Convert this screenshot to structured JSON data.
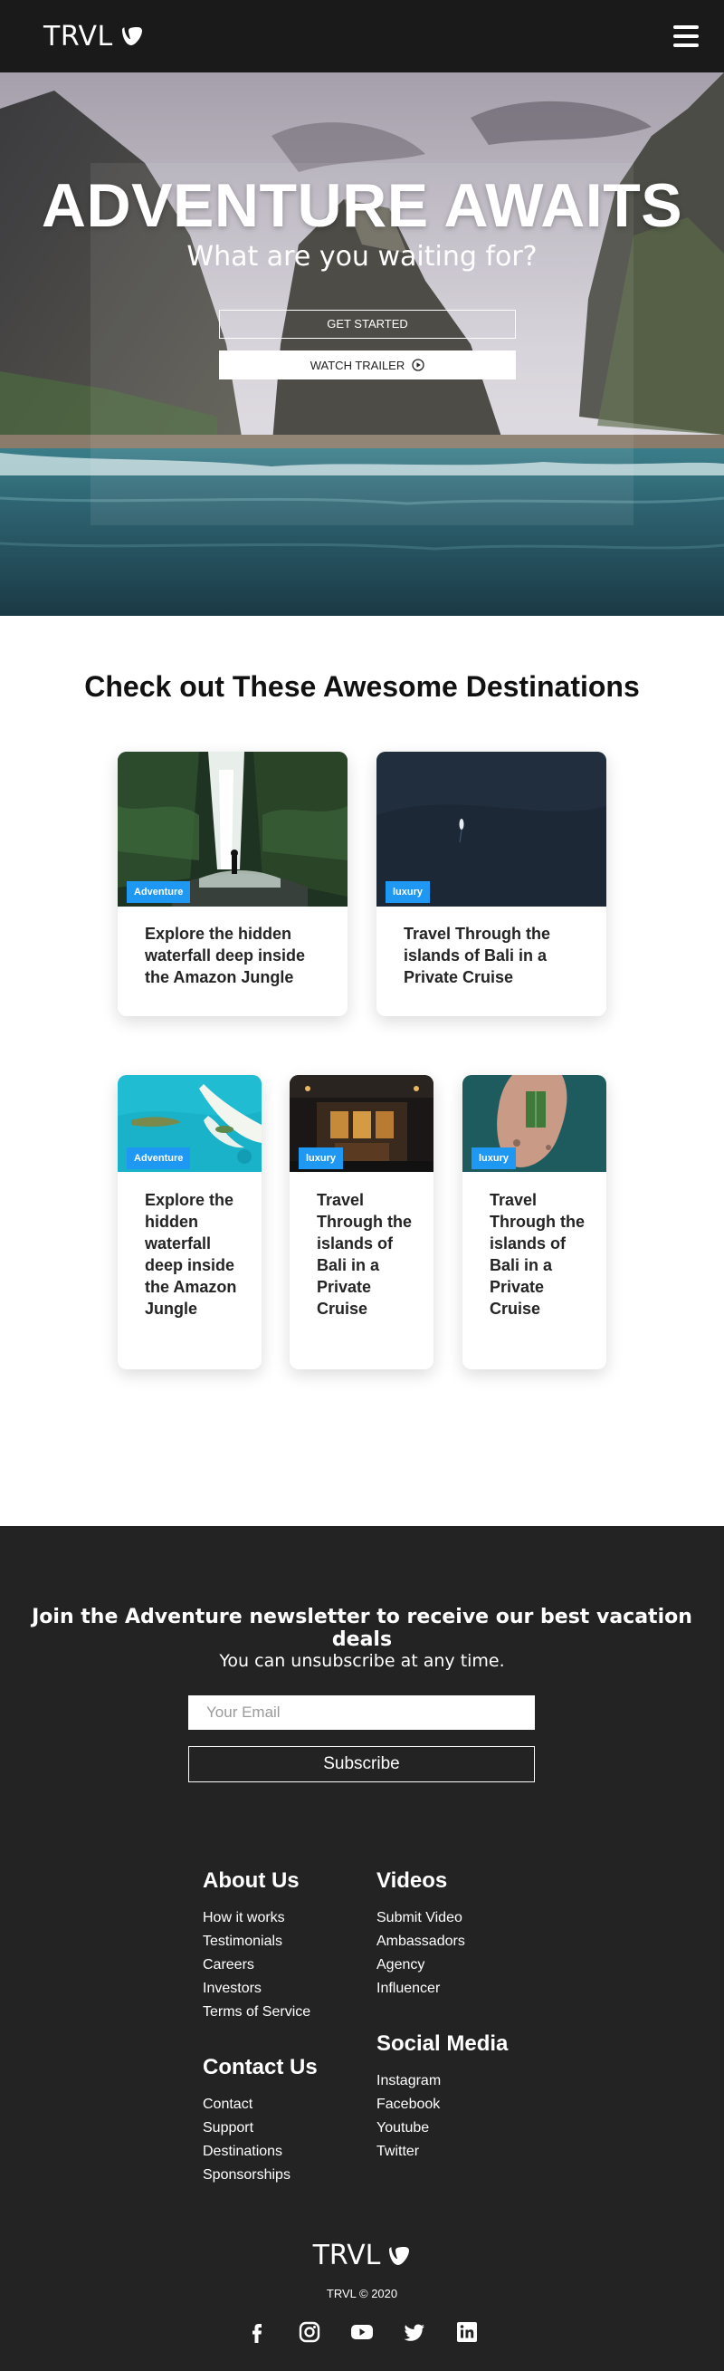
{
  "brand": {
    "name": "TRVL"
  },
  "hero": {
    "title": "ADVENTURE AWAITS",
    "subtitle": "What are you waiting for?",
    "get_started_label": "GET STARTED",
    "watch_trailer_label": "WATCH TRAILER"
  },
  "destinations": {
    "heading": "Check out These Awesome Destinations",
    "cards": [
      {
        "tag": "Adventure",
        "text": "Explore the hidden waterfall deep inside the Amazon Jungle",
        "image": "waterfall-jungle"
      },
      {
        "tag": "luxury",
        "text": "Travel Through the islands of Bali in a Private Cruise",
        "image": "boat-ocean"
      },
      {
        "tag": "Adventure",
        "text": "Explore the hidden waterfall deep inside the Amazon Jungle",
        "image": "tropical-reef"
      },
      {
        "tag": "luxury",
        "text": "Travel Through the islands of Bali in a Private Cruise",
        "image": "night-building"
      },
      {
        "tag": "luxury",
        "text": "Travel Through the islands of Bali in a Private Cruise",
        "image": "island-field"
      }
    ]
  },
  "newsletter": {
    "title": "Join the Adventure newsletter to receive our best vacation deals",
    "subtitle": "You can unsubscribe at any time.",
    "email_placeholder": "Your Email",
    "subscribe_label": "Subscribe"
  },
  "footer": {
    "about": {
      "title": "About Us",
      "links": [
        "How it works",
        "Testimonials",
        "Careers",
        "Investors",
        "Terms of Service"
      ]
    },
    "videos": {
      "title": "Videos",
      "links": [
        "Submit Video",
        "Ambassadors",
        "Agency",
        "Influencer"
      ]
    },
    "contact": {
      "title": "Contact Us",
      "links": [
        "Contact",
        "Support",
        "Destinations",
        "Sponsorships"
      ]
    },
    "social": {
      "title": "Social Media",
      "links": [
        "Instagram",
        "Facebook",
        "Youtube",
        "Twitter"
      ]
    },
    "copyright": "TRVL © 2020",
    "social_icons": [
      "facebook-icon",
      "instagram-icon",
      "youtube-icon",
      "twitter-icon",
      "linkedin-icon"
    ]
  },
  "colors": {
    "navbar": "#1a1a1a",
    "footer": "#232323",
    "tag": "#1f98f4",
    "card_text": "#242424"
  }
}
